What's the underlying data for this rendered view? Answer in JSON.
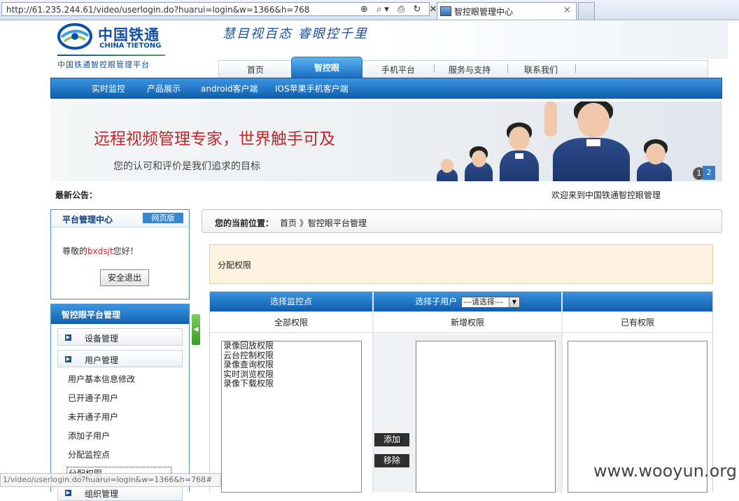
{
  "browser": {
    "url": "http://61.235.244.61/video/userlogin.do?huarui=login&w=1366&h=768",
    "tab_title": "智控眼管理中心",
    "tab_close": "×",
    "toolbar_icons": "⊕ ⌕▾ ⎙ ↻ ✕"
  },
  "header": {
    "logo_cn": "中国铁通",
    "logo_en": "CHINA TIETONG",
    "logo_subtitle": "中国铁通智控眼管理平台",
    "slogan": "慧目视百态 睿眼控千里"
  },
  "main_nav": {
    "items": [
      "首页",
      "智控眼",
      "手机平台",
      "服务与支持",
      "联系我们"
    ],
    "active": "智控眼"
  },
  "sub_nav": {
    "items": [
      "实时监控",
      "产品展示",
      "android客户端",
      "IOS苹果手机客户端"
    ]
  },
  "banner": {
    "title": "远程视频管理专家，世界触手可及",
    "subtitle": "您的认可和评价是我们追求的目标",
    "pages": [
      "1",
      "2"
    ]
  },
  "notice": {
    "label": "最新公告：",
    "marquee": "欢迎来到中国铁通智控眼管理"
  },
  "left_panel": {
    "title": "平台管理中心",
    "badge": "网页版",
    "greeting_prefix": "尊敬的",
    "username": "bxdsjt",
    "greeting_suffix": "您好！",
    "logout": "安全退出"
  },
  "platform_menu": {
    "title": "智控眼平台管理",
    "groups": [
      "设备管理",
      "用户管理"
    ],
    "user_items": [
      "用户基本信息修改",
      "已开通子用户",
      "未开通子用户",
      "添加子用户",
      "分配监控点",
      "分配权限"
    ],
    "next_group_partial": "组织管理",
    "active_item": "分配权限",
    "toggle_arrow": "◀"
  },
  "breadcrumb": {
    "label": "您的当前位置：",
    "path": "首页 》智控眼平台管理"
  },
  "page_title": "分配权限",
  "permissions": {
    "col1_header": "选择监控点",
    "col2_header": "选择子用户",
    "col3_header": "",
    "select_value": "---请选择---",
    "sub_all": "全部权限",
    "sub_new": "新增权限",
    "sub_existing": "已有权限",
    "all_list": [
      "录像回放权限",
      "云台控制权限",
      "录像查询权限",
      "实时浏览权限",
      "录像下载权限"
    ],
    "add": "添加",
    "remove": "移除"
  },
  "status_bar": "1/video/userlogin.do?huarui=login&w=1366&h=768#",
  "watermark": "www.wooyun.org",
  "colors": {
    "brand_blue": "#0f4fa5",
    "nav_blue": "#1a6fc4",
    "banner_red": "#c0262b",
    "title_bg": "#fdf3de"
  }
}
